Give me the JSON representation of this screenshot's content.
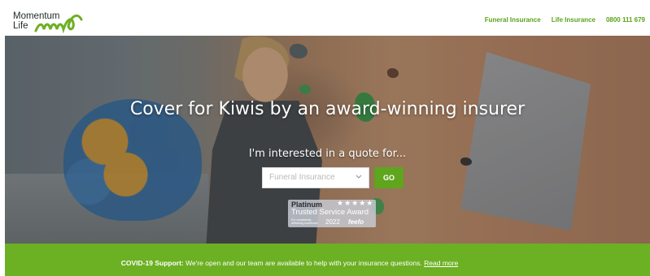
{
  "brand": {
    "logo_line1": "Momentum",
    "logo_line2": "Life",
    "accent_color": "#5aa319"
  },
  "nav": {
    "items": [
      {
        "label": "Funeral Insurance"
      },
      {
        "label": "Life Insurance"
      },
      {
        "label": "0800 111 679"
      }
    ]
  },
  "hero": {
    "title": "Cover for Kiwis by an award-winning insurer",
    "subtitle": "I'm interested in a quote for...",
    "select_value": "Funeral Insurance",
    "go_label": "GO"
  },
  "award": {
    "tier": "Platinum",
    "name": "Trusted Service Award",
    "caption": "For consistently delivering excellence",
    "year": "2022",
    "brand": "feefo"
  },
  "banner": {
    "bold": "COVID-19 Support:",
    "text": " We're open and our team are available to help with your insurance questions. ",
    "link": "Read more",
    "color": "#6cb023"
  }
}
